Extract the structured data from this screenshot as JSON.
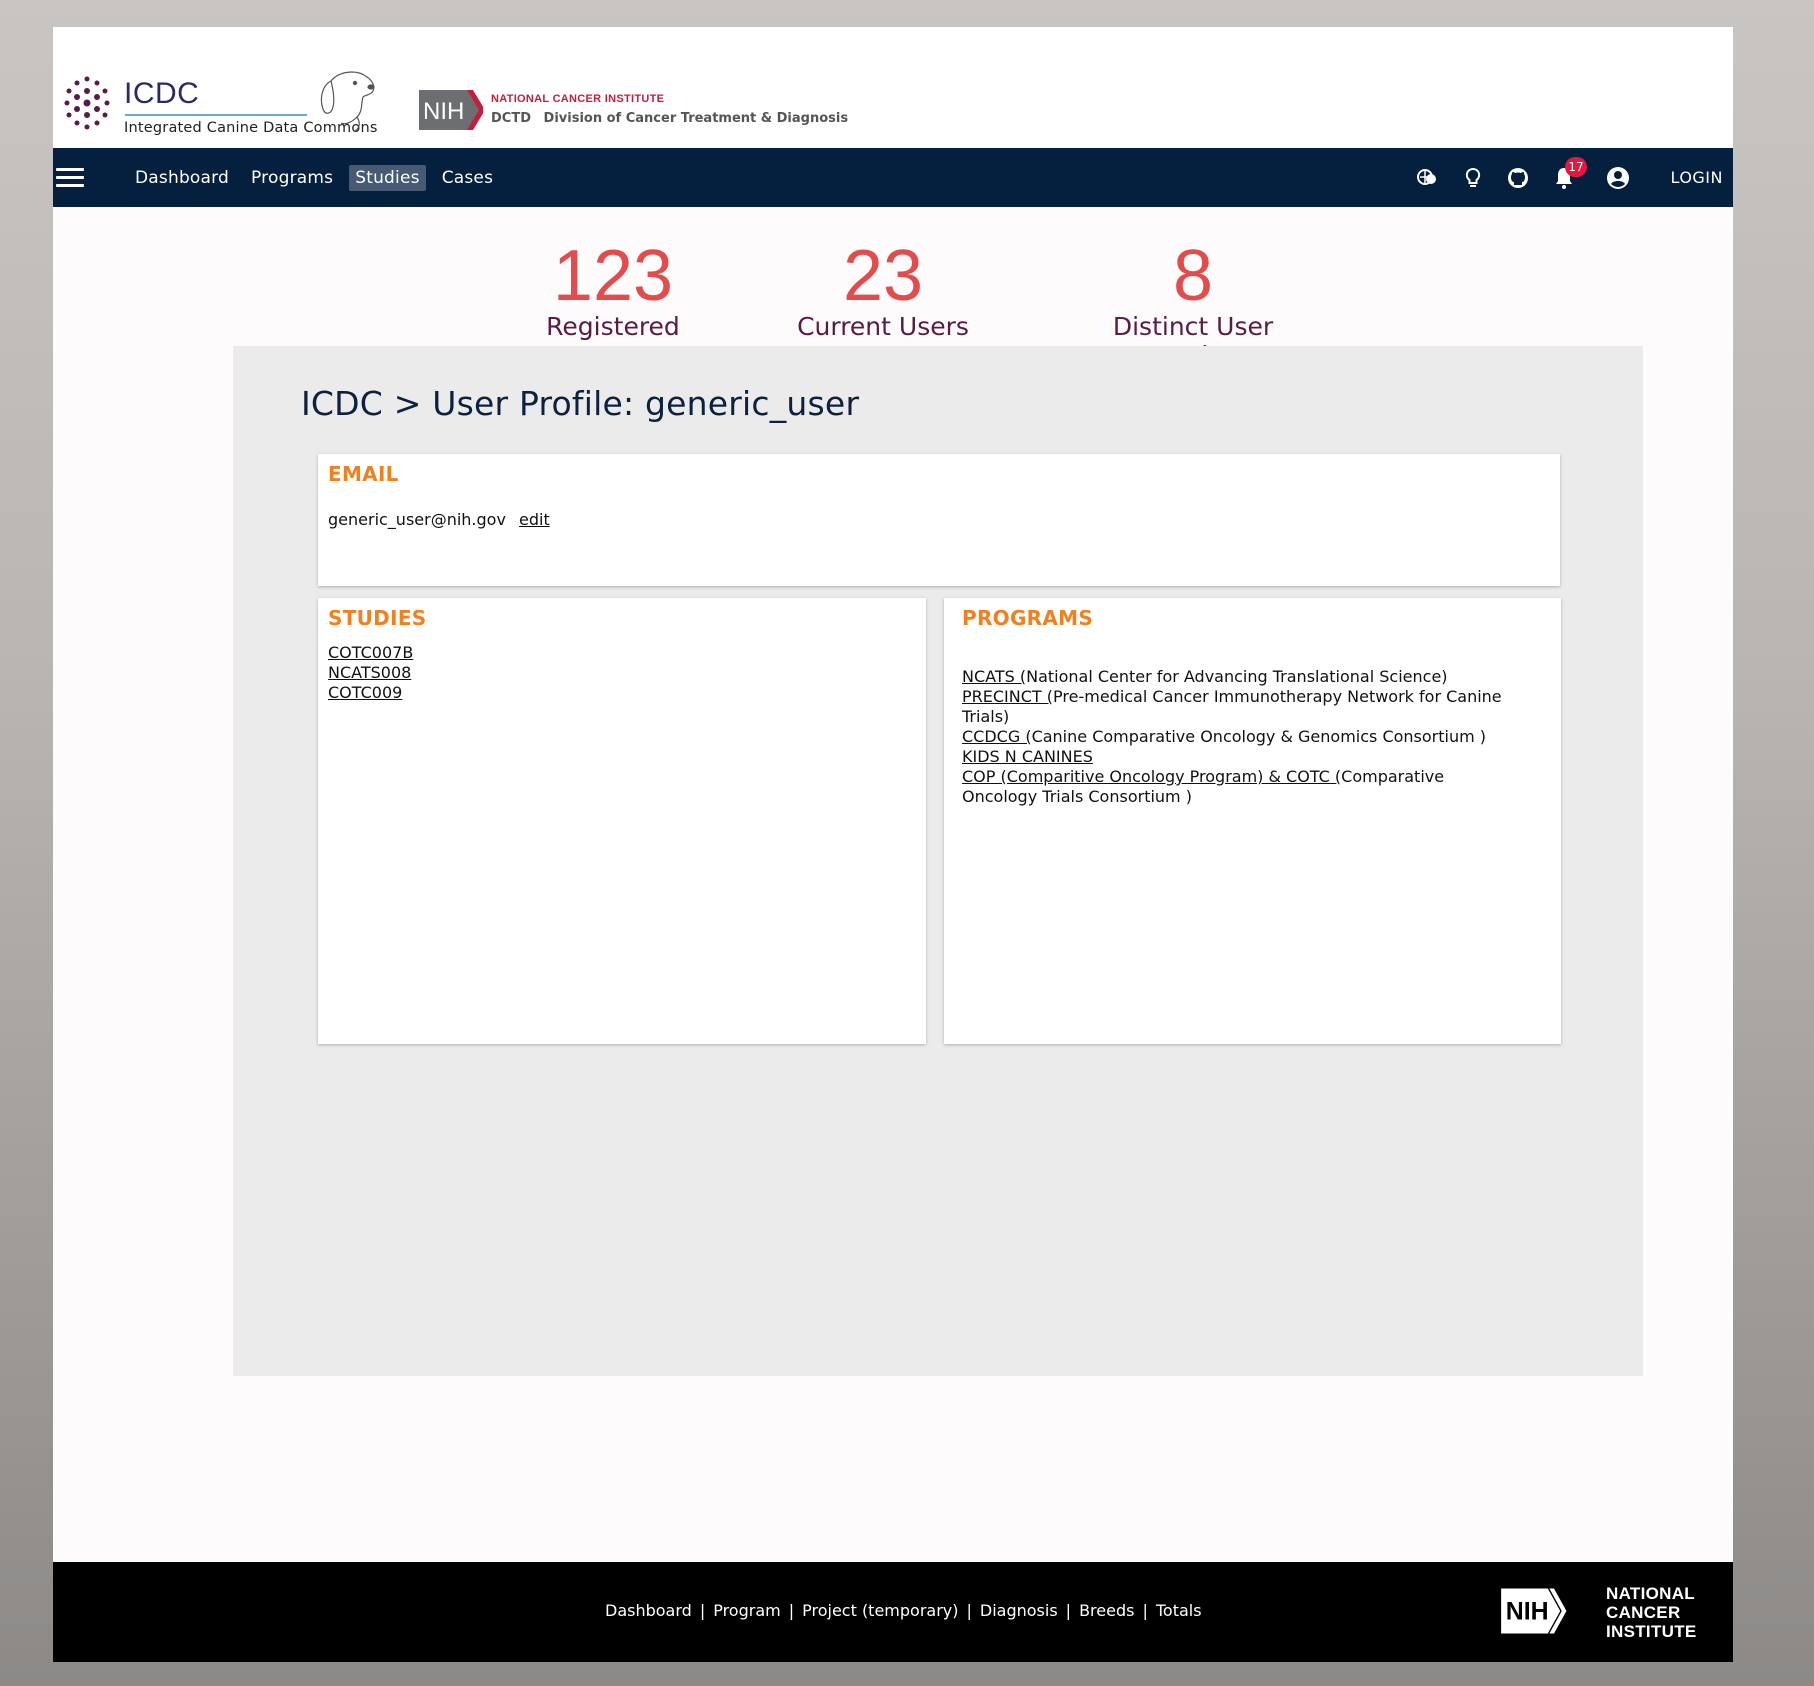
{
  "header": {
    "logo_title": "ICDC",
    "logo_subtitle": "Integrated Canine Data Commons",
    "nih_badge": "NIH",
    "nci_name": "NATIONAL CANCER INSTITUTE",
    "dctd_abbr": "DCTD",
    "dctd_name": "Division of Cancer Treatment & Diagnosis"
  },
  "nav": {
    "items": [
      {
        "label": "Dashboard",
        "active": false
      },
      {
        "label": "Programs",
        "active": false
      },
      {
        "label": "Studies",
        "active": true
      },
      {
        "label": "Cases",
        "active": false
      }
    ],
    "notification_count": "17",
    "login_label": "LOGIN",
    "icons": [
      "translate-icon",
      "lightbulb-icon",
      "github-icon",
      "bell-icon",
      "account-icon"
    ]
  },
  "stats": [
    {
      "value": "123",
      "label": "Registered Users"
    },
    {
      "value": "23",
      "label": "Current Users"
    },
    {
      "value": "8",
      "label": "Distinct User Locations"
    }
  ],
  "profile": {
    "breadcrumb": "ICDC > User Profile: generic_user",
    "email_title": "EMAIL",
    "email": "generic_user@nih.gov",
    "edit_label": "edit",
    "studies_title": "STUDIES",
    "studies": [
      "COTC007B",
      "NCATS008",
      "COTC009"
    ],
    "programs_title": "PROGRAMS",
    "programs": [
      {
        "link": "NCATS (",
        "desc": "National Center for Advancing Translational Science)"
      },
      {
        "link": "PRECINCT (",
        "desc": "Pre-medical Cancer Immunotherapy Network for Canine Trials)"
      },
      {
        "link": "CCDCG (",
        "desc": "Canine Comparative Oncology & Genomics Consortium )"
      },
      {
        "link": "KIDS N CANINES",
        "desc": ""
      },
      {
        "link": "COP (Comparitive Oncology Program) & COTC (",
        "desc": "Comparative Oncology Trials Consortium )"
      }
    ]
  },
  "footer": {
    "links": [
      "Dashboard",
      "Program",
      "Project (temporary)",
      "Diagnosis",
      "Breeds",
      "Totals"
    ],
    "nih_badge": "NIH",
    "nci_lines": [
      "NATIONAL",
      "CANCER",
      "INSTITUTE"
    ]
  },
  "colors": {
    "nav_bg": "#05203f",
    "stat_number": "#e34c4c",
    "stat_label": "#5a1a45",
    "card_title": "#f0811f",
    "badge": "#e4183e"
  }
}
